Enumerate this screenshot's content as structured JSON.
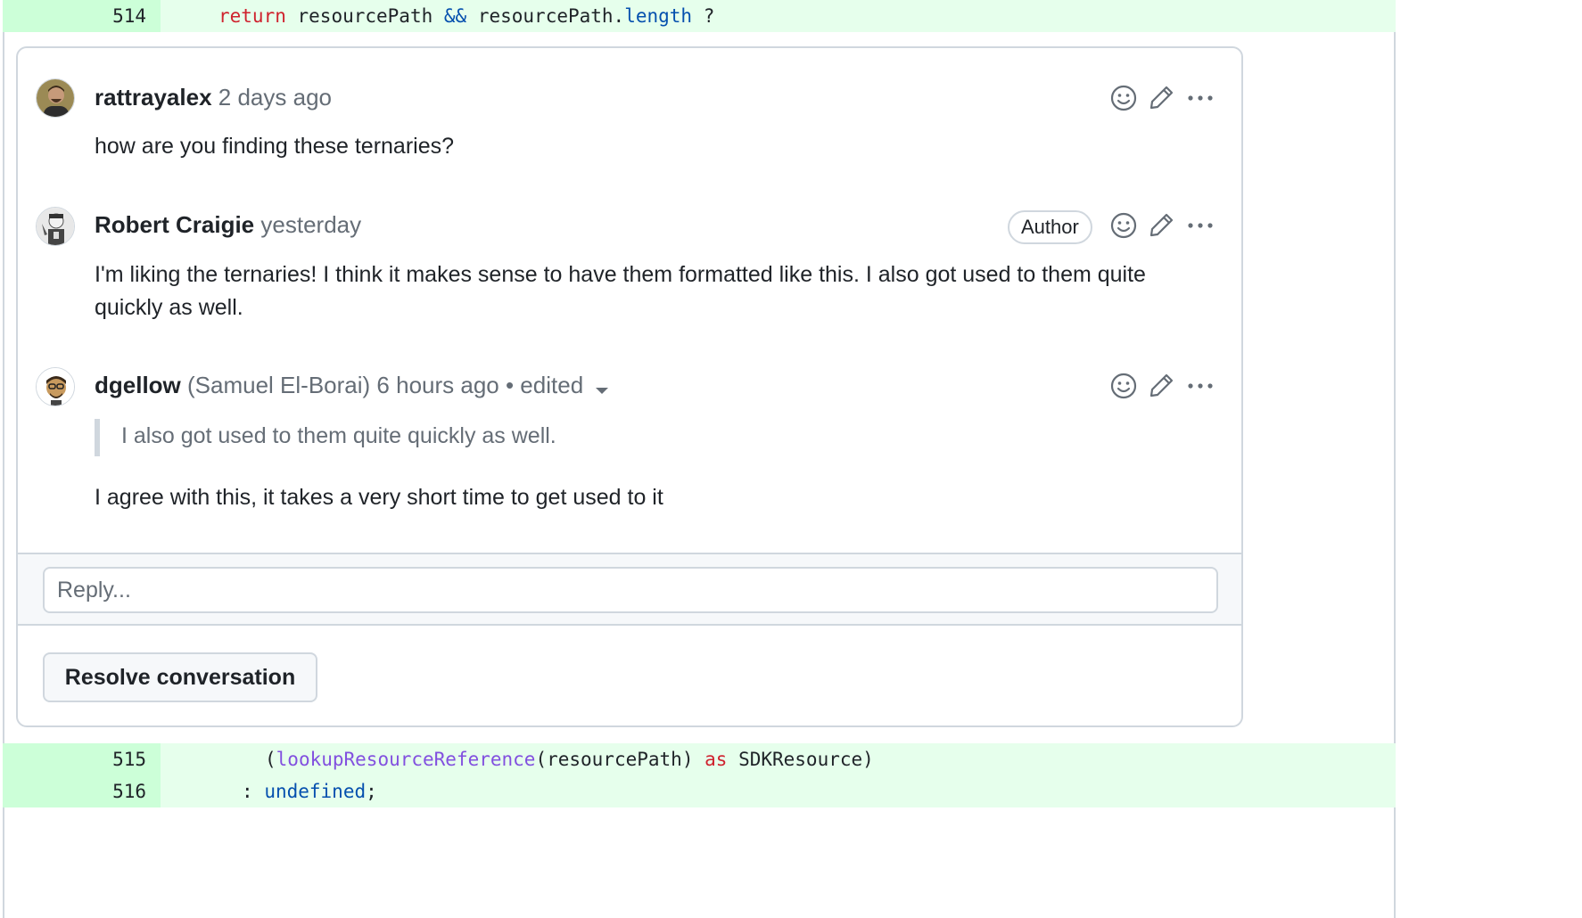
{
  "diff": {
    "line_514": {
      "num": "514",
      "kw": "return",
      "a": "resourcePath",
      "op": "&&",
      "b": "resourcePath.",
      "prop": "length",
      "tail": "?"
    },
    "line_515": {
      "num": "515",
      "open": "(",
      "fn": "lookupResourceReference",
      "mid": "(resourcePath)",
      "kw": "as",
      "tail": "SDKResource)"
    },
    "line_516": {
      "num": "516",
      "colon": ":",
      "val": "undefined",
      "semi": ";"
    }
  },
  "comments": [
    {
      "author": "rattrayalex",
      "time": "2 days ago",
      "body": "how are you finding these ternaries?"
    },
    {
      "author": "Robert Craigie",
      "time": "yesterday",
      "badge": "Author",
      "body": "I'm liking the ternaries! I think it makes sense to have them formatted like this. I also got used to them quite quickly as well."
    },
    {
      "author": "dgellow",
      "fullname": "(Samuel El-Borai)",
      "time": "6 hours ago",
      "edited": "• edited",
      "quote": "I also got used to them quite quickly as well.",
      "body": "I agree with this, it takes a very short time to get used to it"
    }
  ],
  "reply": {
    "placeholder": "Reply..."
  },
  "resolve_label": "Resolve conversation",
  "icons": {
    "reaction": "smiley-icon",
    "edit": "pencil-icon",
    "menu": "kebab-horizontal-icon"
  },
  "colors": {
    "added_bg": "#e6ffec",
    "gutter_bg": "#ccffd8",
    "keyword": "#cf222e",
    "property": "#0550ae",
    "function": "#8250df",
    "border": "#d0d7de"
  }
}
